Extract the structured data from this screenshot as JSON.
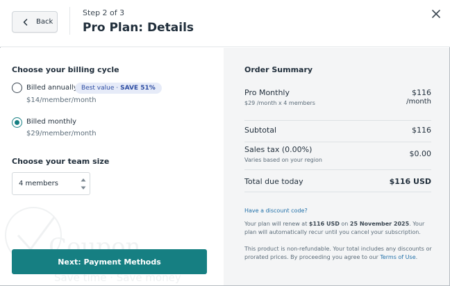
{
  "header": {
    "back_label": "Back",
    "step": "Step 2 of 3",
    "title": "Pro Plan: Details"
  },
  "billing": {
    "heading": "Choose your billing cycle",
    "options": [
      {
        "label": "Billed annually",
        "price": "$14/member/month",
        "selected": false,
        "badge_text": "Best value ·",
        "badge_strong": "SAVE 51%"
      },
      {
        "label": "Billed monthly",
        "price": "$29/member/month",
        "selected": true
      }
    ]
  },
  "team": {
    "heading": "Choose your team size",
    "value": "4 members"
  },
  "watermark": {
    "word": "Coupon",
    "tagline": "Save time · Save money"
  },
  "next_button": "Next: Payment Methods",
  "summary": {
    "title": "Order Summary",
    "plan_label": "Pro Monthly",
    "plan_detail": "$29 /month x 4 members",
    "plan_price": "$116",
    "plan_period": "/month",
    "subtotal_label": "Subtotal",
    "subtotal_value": "$116",
    "tax_label": "Sales tax (0.00%)",
    "tax_note": "Varies based on your region",
    "tax_value": "$0.00",
    "total_label": "Total due today",
    "total_value": "$116 USD",
    "discount_link": "Have a discount code?",
    "renew_a": "Your plan will renew at ",
    "renew_amount": "$116 USD",
    "renew_b": " on ",
    "renew_date": "25 November 2025",
    "renew_c": ". Your plan will automatically recur until you cancel your subscription.",
    "refund_a": "This product is non-refundable. Your total includes any discounts or prorated prices. By proceeding you agree to our ",
    "terms_link": "Terms of Use",
    "refund_b": "."
  },
  "colors": {
    "accent": "#167f82",
    "badge_bg": "#e6ebf8",
    "badge_text": "#2f4ea3",
    "panel_bg": "#f4f5f6",
    "link": "#1f6fa8"
  }
}
